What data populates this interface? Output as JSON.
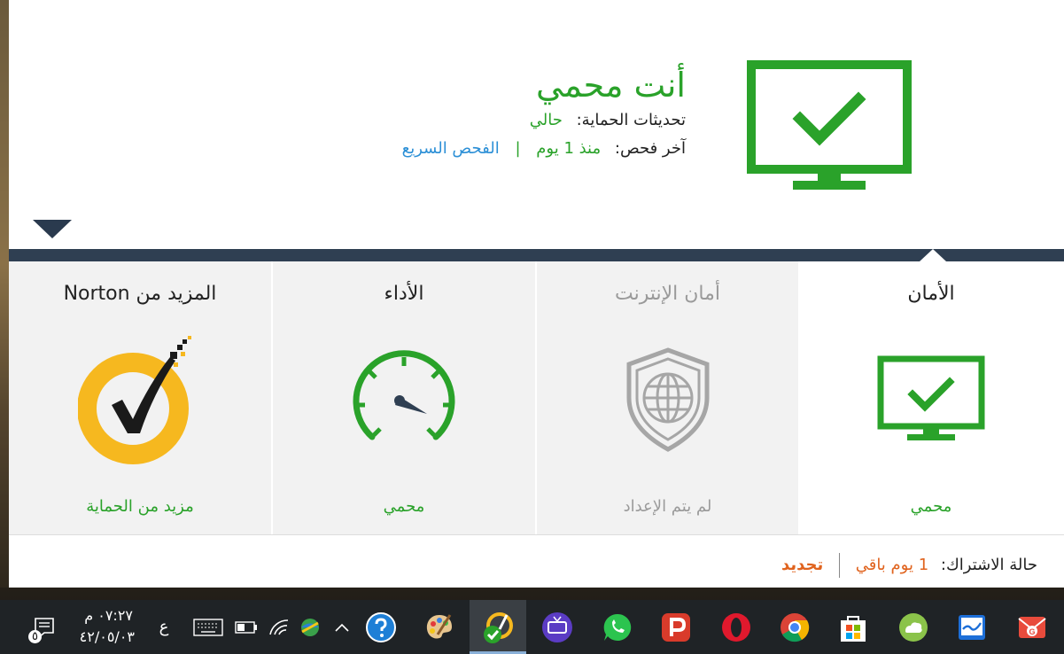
{
  "header": {
    "title": "أنت محمي",
    "updates_label": "تحديثات الحماية:",
    "updates_value": "حالي",
    "last_scan_label": "آخر فحص:",
    "last_scan_value": "منذ 1 يوم",
    "separator": "|",
    "quick_scan_link": "الفحص السريع"
  },
  "tiles": {
    "security": {
      "title": "الأمان",
      "status": "محمي",
      "icon": "monitor-check-icon"
    },
    "internet": {
      "title": "أمان الإنترنت",
      "status": "لم يتم الإعداد",
      "icon": "shield-globe-icon"
    },
    "performance": {
      "title": "الأداء",
      "status": "محمي",
      "icon": "speedometer-icon"
    },
    "more": {
      "title": "المزيد من Norton",
      "status": "مزيد من الحماية",
      "icon": "norton-logo-icon"
    }
  },
  "footer": {
    "subscription_label": "حالة الاشتراك:",
    "days_left": "1 يوم باقي",
    "renew_label": "تجديد"
  },
  "taskbar": {
    "notification_count": "٥",
    "time": "٠٧:٢٧ م",
    "date": "٤٢/٠٥/٠٣",
    "language": "ع"
  },
  "colors": {
    "green": "#2aa22a",
    "link_blue": "#2b8fd6",
    "orange": "#e0631e",
    "dark_bar": "#2f3f52",
    "norton_yellow": "#f6b81f"
  }
}
